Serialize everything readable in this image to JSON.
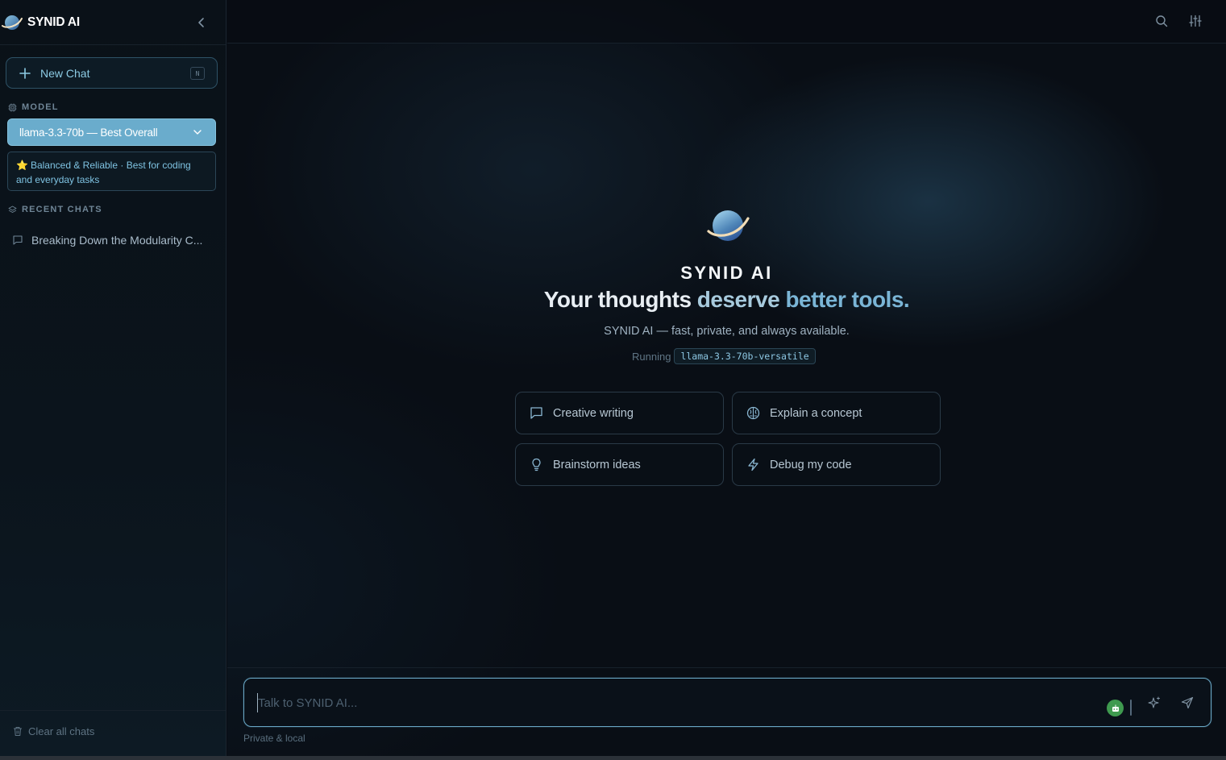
{
  "sidebar": {
    "brand": "SYNID AI",
    "new_chat": {
      "label": "New Chat",
      "shortcut": "N"
    },
    "model_section_label": "MODEL",
    "model_select": {
      "value": "llama-3.3-70b — Best Overall"
    },
    "model_description": {
      "icon": "⭐",
      "text": "Balanced & Reliable · Best for coding and everyday tasks"
    },
    "recent_section_label": "RECENT CHATS",
    "recent_chats": [
      {
        "title": "Breaking Down the Modularity C..."
      }
    ],
    "clear_label": "Clear all chats"
  },
  "topbar": {
    "icons": [
      "search-icon",
      "sliders-icon"
    ]
  },
  "hero": {
    "brand": "SYNID AI",
    "headline_part1": "Your thoughts",
    "headline_part2": "deserve",
    "headline_part3": "better tools.",
    "subtitle": "SYNID AI — fast, private, and always available.",
    "running_label": "Running",
    "running_model": "llama-3.3-70b-versatile"
  },
  "suggestions": [
    {
      "label": "Creative writing",
      "icon": "chat-icon"
    },
    {
      "label": "Explain a concept",
      "icon": "brain-icon"
    },
    {
      "label": "Brainstorm ideas",
      "icon": "lightbulb-icon"
    },
    {
      "label": "Debug my code",
      "icon": "bolt-icon"
    }
  ],
  "composer": {
    "placeholder": "Talk to SYNID AI...",
    "footnote": "Private & local"
  },
  "colors": {
    "accent": "#6aaccc",
    "accent_text": "#7ab5d6",
    "badge_green": "#3f9a4f",
    "background": "#090e15"
  }
}
